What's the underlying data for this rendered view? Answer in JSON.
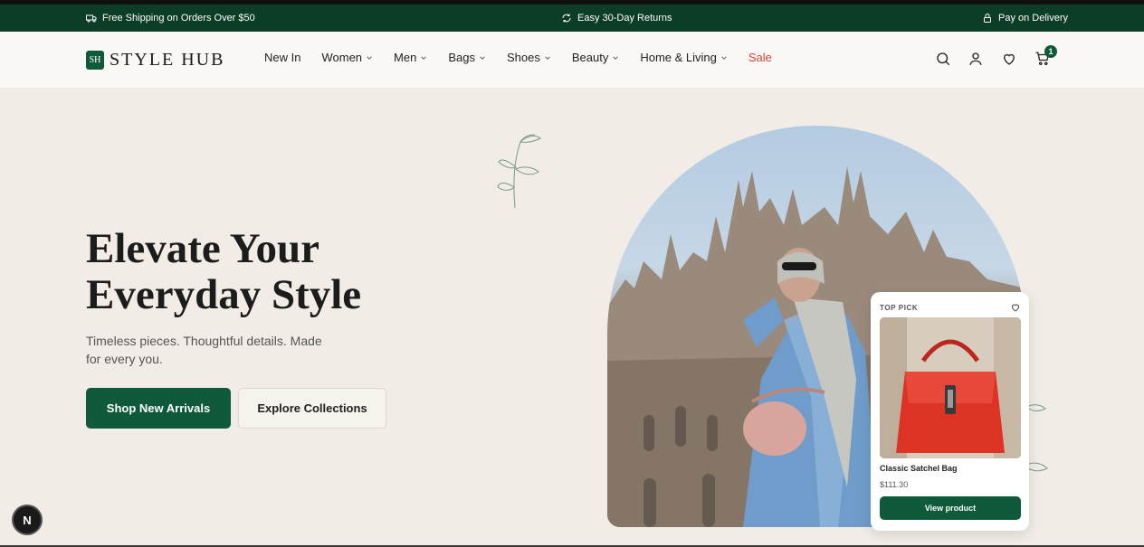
{
  "topbar": {
    "shipping": "Free Shipping on Orders Over $50",
    "returns": "Easy 30-Day Returns",
    "delivery": "Pay on Delivery"
  },
  "logo": {
    "mark": "SH",
    "text": "STYLE HUB"
  },
  "nav": {
    "items": [
      {
        "label": "New In",
        "has_dropdown": false
      },
      {
        "label": "Women",
        "has_dropdown": true
      },
      {
        "label": "Men",
        "has_dropdown": true
      },
      {
        "label": "Bags",
        "has_dropdown": true
      },
      {
        "label": "Shoes",
        "has_dropdown": true
      },
      {
        "label": "Beauty",
        "has_dropdown": true
      },
      {
        "label": "Home & Living",
        "has_dropdown": true
      },
      {
        "label": "Sale",
        "has_dropdown": false
      }
    ]
  },
  "header_icons": {
    "search": "search-icon",
    "account": "user-icon",
    "wishlist": "heart-icon",
    "cart": "cart-icon",
    "cart_count": "1"
  },
  "hero": {
    "title": "Elevate Your Everyday Style",
    "subtitle": "Timeless pieces. Thoughtful details. Made for every you.",
    "primary_cta": "Shop New Arrivals",
    "secondary_cta": "Explore Collections"
  },
  "product_card": {
    "label": "TOP PICK",
    "name": "Classic Satchel Bag",
    "price": "$111.30",
    "cta": "View product"
  },
  "dev_badge": "N",
  "colors": {
    "brand_green": "#0f5a3b",
    "topbar_green": "#0c3d27",
    "sale_red": "#d5453a",
    "background": "#f1ece5"
  }
}
